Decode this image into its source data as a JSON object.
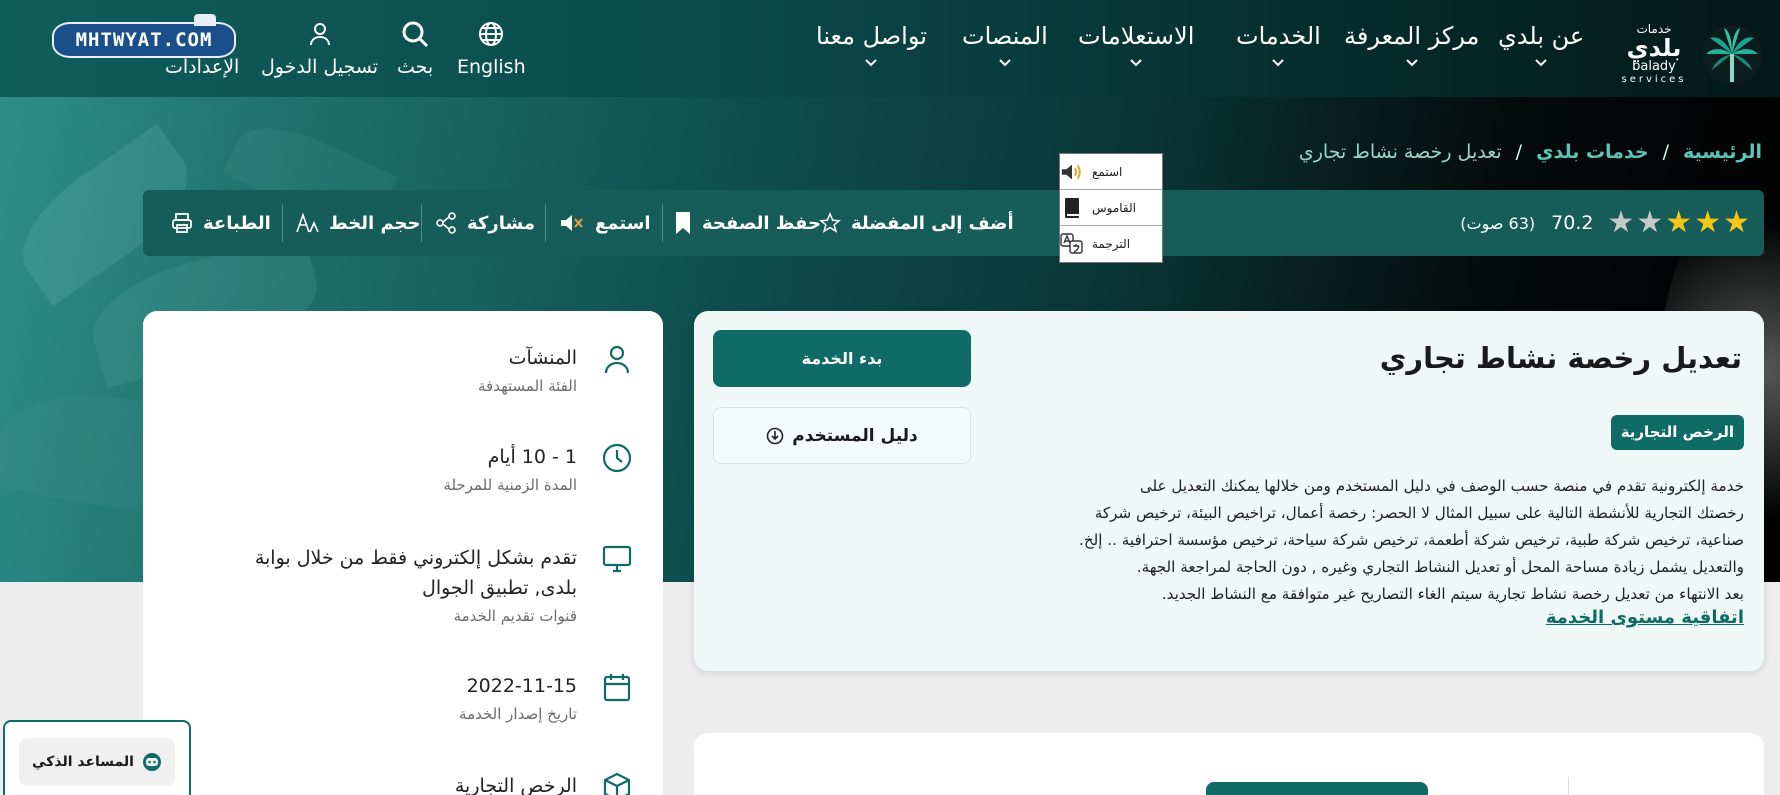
{
  "header": {
    "brand_logo_text": "MHTWYAT.COM",
    "settings_label": "الإعدادات",
    "login_label": "تسجيل الدخول",
    "search_label": "بحث",
    "language_label": "English",
    "nav": [
      {
        "label": "تواصل معنا"
      },
      {
        "label": "المنصات"
      },
      {
        "label": "الاستعلامات"
      },
      {
        "label": "الخدمات"
      },
      {
        "label": "مركز المعرفة"
      },
      {
        "label": "عن بلدي"
      }
    ],
    "logo": {
      "ar_small": "خدمات",
      "ar_big": "بلدي",
      "en": "balady",
      "en_sub": "services"
    }
  },
  "breadcrumb": {
    "home": "الرئيسية",
    "section": "خدمات بلدي",
    "current": "تعديل رخصة نشاط تجاري",
    "separator": "/"
  },
  "read_popup": {
    "listen": "استمع",
    "dictionary": "القاموس",
    "translate": "الترجمة"
  },
  "toolbar": {
    "print": "الطباعة",
    "font_size": "حجم الخط",
    "share": "مشاركة",
    "listen": "استمع",
    "save_page": "حفظ الصفحة",
    "add_favorite": "أضف إلى المفضلة",
    "rating_value": "70.2",
    "votes": "(63 صوت)",
    "stars_filled": 3,
    "stars_total": 5
  },
  "service": {
    "title": "تعديل رخصة نشاط تجاري",
    "start_button": "بدء الخدمة",
    "guide_button": "دليل المستخدم",
    "tag": "الرخص التجارية",
    "description": [
      "خدمة إلكترونية تقدم في منصة حسب الوصف في دليل المستخدم ومن خلالها يمكنك التعديل على",
      "رخصتك التجارية للأنشطة التالية على سبيل المثال لا الحصر: رخصة أعمال، تراخيص البيئة، ترخيص شركة",
      "صناعية، ترخيص شركة طبية، ترخيص شركة أطعمة، ترخيص شركة سياحة، ترخيص مؤسسة احترافية .. إلخ.",
      "والتعديل يشمل زيادة مساحة المحل أو تعديل النشاط التجاري وغيره , دون الحاجة لمراجعة الجهة.",
      "بعد الانتهاء من تعديل رخصة نشاط تجارية سيتم الغاء التصاريح غير متوافقة مع النشاط الجديد."
    ],
    "sla_link": "اتفاقية مستوى الخدمة"
  },
  "facts": [
    {
      "value": "المنشآت",
      "label": "الفئة المستهدفة",
      "icon": "user-icon"
    },
    {
      "value": "1 - 10 أيام",
      "label": "المدة الزمنية للمرحلة",
      "icon": "clock-icon"
    },
    {
      "value": "تقدم بشكل إلكتروني فقط من خلال بوابة بلدى, تطبيق الجوال",
      "label": "قنوات تقديم الخدمة",
      "icon": "monitor-icon"
    },
    {
      "value": "2022-11-15",
      "label": "تاريخ إصدار الخدمة",
      "icon": "calendar-icon"
    },
    {
      "value": "الرخص التجارية",
      "label": "",
      "icon": "box-icon"
    }
  ],
  "assistant": {
    "label": "المساعد الذكي"
  },
  "colors": {
    "primary": "#0f6b66",
    "toolbar": "#165c59",
    "accent_link": "#5cc4b8",
    "star": "#f5c518"
  }
}
